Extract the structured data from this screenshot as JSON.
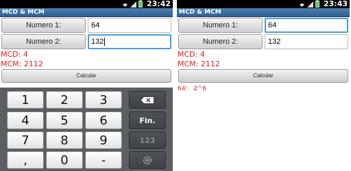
{
  "statusbar": {
    "time": "23:42"
  },
  "statusbar_right": {
    "time": "23:43"
  },
  "app": {
    "title": "MCD & MCM"
  },
  "left": {
    "numero1_label": "Numero 1:",
    "numero1_value": "64",
    "numero2_label": "Numero 2:",
    "numero2_value": "132",
    "mcd": "MCD: 4",
    "mcm": "MCM: 2112",
    "calc_label": "Calcular"
  },
  "right": {
    "numero1_label": "Numero 1:",
    "numero1_value": "64",
    "numero2_label": "Numero 2:",
    "numero2_value": "132",
    "mcd": "MCD: 4",
    "mcm": "MCM: 2112",
    "calc_label": "Calcular",
    "factorization": "64:   2^6"
  },
  "keyboard": {
    "keys": [
      "1",
      "2",
      "3",
      "4",
      "5",
      "6",
      "7",
      "8",
      "9",
      ",",
      "0",
      "-"
    ],
    "fin_label": "Fin.",
    "numpad_label": "123",
    "icons": {
      "backspace": "backspace-icon",
      "settings": "settings-icon"
    }
  }
}
